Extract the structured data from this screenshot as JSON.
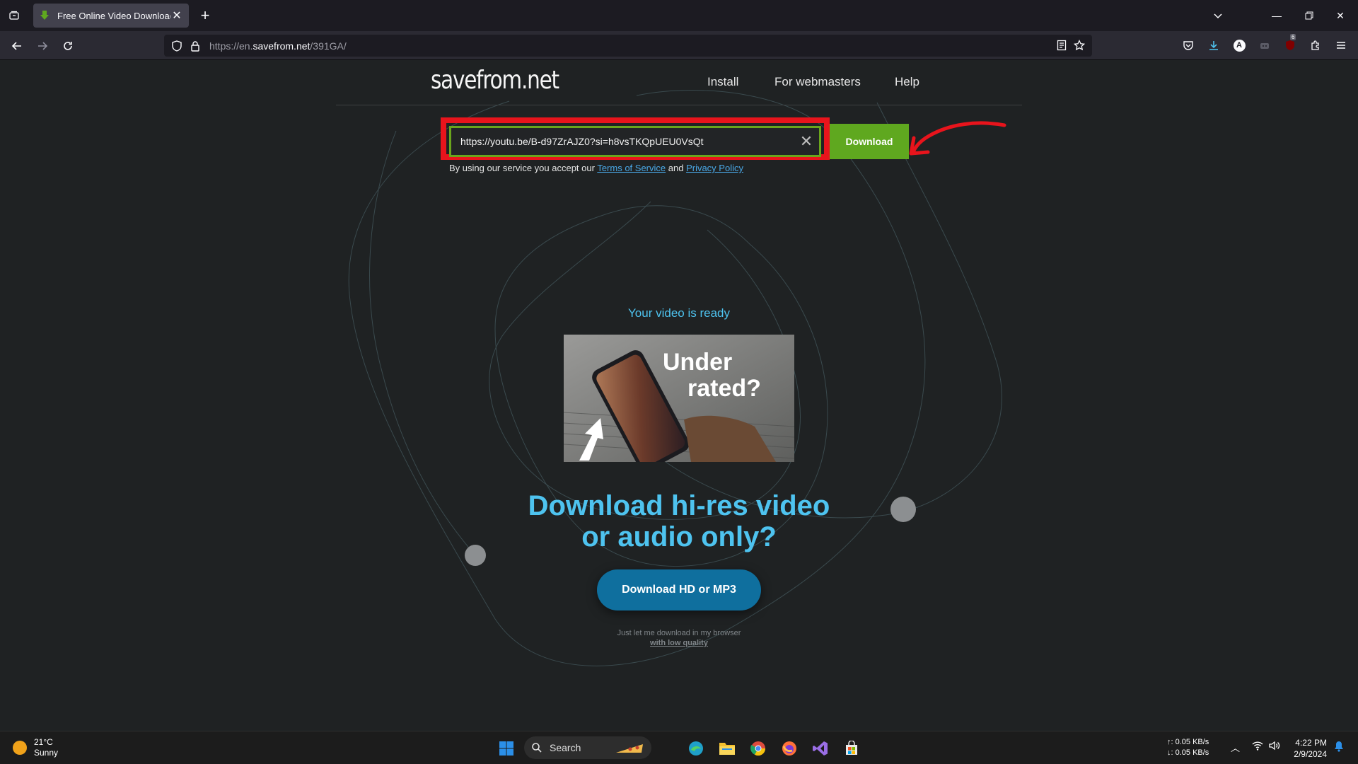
{
  "browser": {
    "tab_title": "Free Online Video Downloader",
    "url_prefix": "https://en.",
    "url_host": "savefrom.net",
    "url_path": "/391GA/",
    "downloads_badge": "6"
  },
  "site": {
    "logo": "savefrom.net",
    "menu": [
      "Install",
      "For webmasters",
      "Help"
    ]
  },
  "form": {
    "input_value": "https://youtu.be/B-d97ZrAJZ0?si=h8vsTKQpUEU0VsQt",
    "download_label": "Download",
    "tos_prefix": "By using our service you accept our ",
    "tos_link": "Terms of Service",
    "tos_and": " and ",
    "privacy_link": "Privacy Policy"
  },
  "result": {
    "ready_text": "Your video is ready",
    "thumb_text_line1": "Under",
    "thumb_text_line2": "rated?",
    "headline_line1": "Download hi-res video",
    "headline_line2": "or audio only?",
    "hd_button": "Download HD or MP3",
    "low_quality_note": "Just let me download in my browser",
    "low_quality_link": "with low quality"
  },
  "taskbar": {
    "temperature": "21°C",
    "condition": "Sunny",
    "search_placeholder": "Search",
    "upload_speed": "↑: 0.05 KB/s",
    "download_speed": "↓: 0.05 KB/s",
    "time": "4:22 PM",
    "date": "2/9/2024"
  },
  "colors": {
    "accent_green": "#5fa81f",
    "highlight_red": "#e8141c",
    "cyan_text": "#4ec3ef",
    "hd_button": "#0f6f9e"
  }
}
